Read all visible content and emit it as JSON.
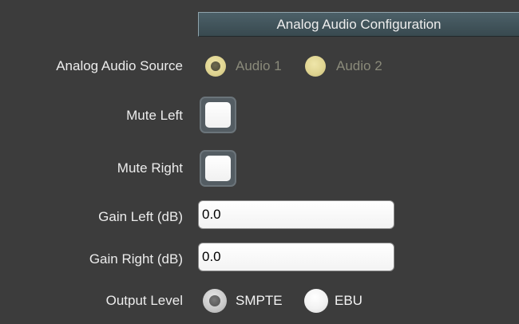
{
  "header": {
    "title": "Analog Audio Configuration"
  },
  "source": {
    "label": "Analog Audio Source",
    "options": [
      {
        "label": "Audio 1",
        "selected": true
      },
      {
        "label": "Audio 2",
        "selected": false
      }
    ]
  },
  "mute_left": {
    "label": "Mute Left",
    "checked": false
  },
  "mute_right": {
    "label": "Mute Right",
    "checked": false
  },
  "gain_left": {
    "label": "Gain Left (dB)",
    "value": "0.0"
  },
  "gain_right": {
    "label": "Gain Right (dB)",
    "value": "0.0"
  },
  "output_level": {
    "label": "Output Level",
    "options": [
      {
        "label": "SMPTE",
        "selected": true
      },
      {
        "label": "EBU",
        "selected": false
      }
    ]
  },
  "colors": {
    "background": "#3c3c3c",
    "header_bg": "#43565e",
    "disabled_radio": "#e0d592"
  }
}
